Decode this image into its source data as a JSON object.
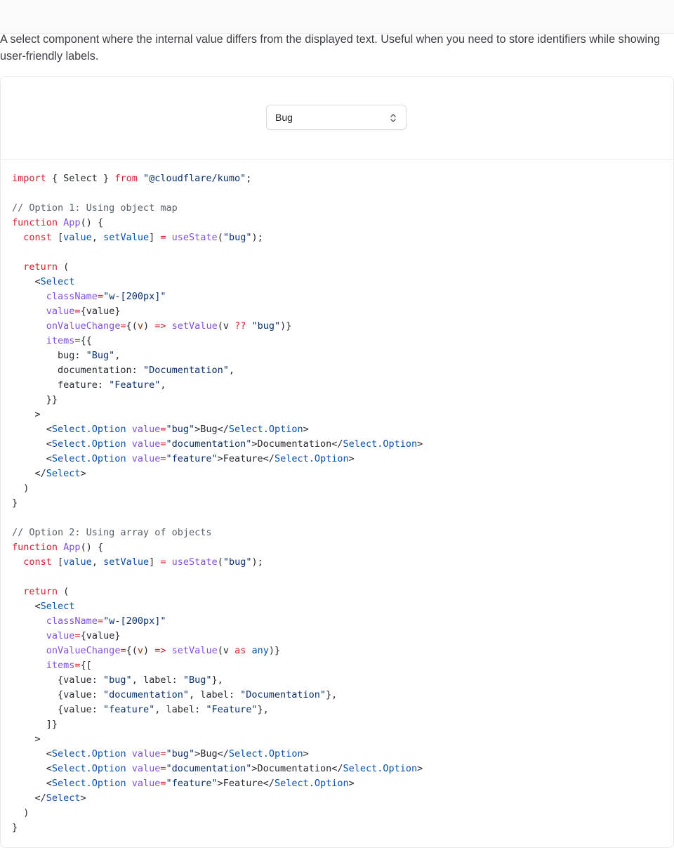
{
  "page": {
    "description": "A select component where the internal value differs from the displayed text. Useful when you need to store identifiers while showing user-friendly labels."
  },
  "preview": {
    "select_value": "Bug",
    "caret_icon": "chevron-up-down-icon"
  },
  "code": {
    "lines": [
      [
        {
          "t": "import",
          "c": "kw"
        },
        {
          "t": " { Select } ",
          "c": ""
        },
        {
          "t": "from",
          "c": "kw"
        },
        {
          "t": " ",
          "c": ""
        },
        {
          "t": "\"@cloudflare/kumo\"",
          "c": "str"
        },
        {
          "t": ";",
          "c": ""
        }
      ],
      [],
      [
        {
          "t": "// Option 1: Using object map",
          "c": "cm"
        }
      ],
      [
        {
          "t": "function",
          "c": "kw"
        },
        {
          "t": " ",
          "c": ""
        },
        {
          "t": "App",
          "c": "fn"
        },
        {
          "t": "() {",
          "c": ""
        }
      ],
      [
        {
          "t": "  ",
          "c": ""
        },
        {
          "t": "const",
          "c": "kw"
        },
        {
          "t": " [",
          "c": ""
        },
        {
          "t": "value",
          "c": "var"
        },
        {
          "t": ", ",
          "c": ""
        },
        {
          "t": "setValue",
          "c": "var"
        },
        {
          "t": "] ",
          "c": ""
        },
        {
          "t": "=",
          "c": "op"
        },
        {
          "t": " ",
          "c": ""
        },
        {
          "t": "useState",
          "c": "fn"
        },
        {
          "t": "(",
          "c": ""
        },
        {
          "t": "\"bug\"",
          "c": "str"
        },
        {
          "t": ");",
          "c": ""
        }
      ],
      [],
      [
        {
          "t": "  ",
          "c": ""
        },
        {
          "t": "return",
          "c": "kw"
        },
        {
          "t": " (",
          "c": ""
        }
      ],
      [
        {
          "t": "    <",
          "c": ""
        },
        {
          "t": "Select",
          "c": "tag"
        }
      ],
      [
        {
          "t": "      ",
          "c": ""
        },
        {
          "t": "className",
          "c": "attr"
        },
        {
          "t": "=",
          "c": "op"
        },
        {
          "t": "\"w-[200px]\"",
          "c": "str"
        }
      ],
      [
        {
          "t": "      ",
          "c": ""
        },
        {
          "t": "value",
          "c": "attr"
        },
        {
          "t": "=",
          "c": "op"
        },
        {
          "t": "{value}",
          "c": ""
        }
      ],
      [
        {
          "t": "      ",
          "c": ""
        },
        {
          "t": "onValueChange",
          "c": "attr"
        },
        {
          "t": "=",
          "c": "op"
        },
        {
          "t": "{(",
          "c": ""
        },
        {
          "t": "v",
          "c": "prm"
        },
        {
          "t": ") ",
          "c": ""
        },
        {
          "t": "=>",
          "c": "op"
        },
        {
          "t": " ",
          "c": ""
        },
        {
          "t": "setValue",
          "c": "fn"
        },
        {
          "t": "(v ",
          "c": ""
        },
        {
          "t": "??",
          "c": "op"
        },
        {
          "t": " ",
          "c": ""
        },
        {
          "t": "\"bug\"",
          "c": "str"
        },
        {
          "t": ")}",
          "c": ""
        }
      ],
      [
        {
          "t": "      ",
          "c": ""
        },
        {
          "t": "items",
          "c": "attr"
        },
        {
          "t": "=",
          "c": "op"
        },
        {
          "t": "{{",
          "c": ""
        }
      ],
      [
        {
          "t": "        bug: ",
          "c": ""
        },
        {
          "t": "\"Bug\"",
          "c": "str"
        },
        {
          "t": ",",
          "c": ""
        }
      ],
      [
        {
          "t": "        documentation: ",
          "c": ""
        },
        {
          "t": "\"Documentation\"",
          "c": "str"
        },
        {
          "t": ",",
          "c": ""
        }
      ],
      [
        {
          "t": "        feature: ",
          "c": ""
        },
        {
          "t": "\"Feature\"",
          "c": "str"
        },
        {
          "t": ",",
          "c": ""
        }
      ],
      [
        {
          "t": "      }}",
          "c": ""
        }
      ],
      [
        {
          "t": "    >",
          "c": ""
        }
      ],
      [
        {
          "t": "      <",
          "c": ""
        },
        {
          "t": "Select.Option",
          "c": "tag"
        },
        {
          "t": " ",
          "c": ""
        },
        {
          "t": "value",
          "c": "attr"
        },
        {
          "t": "=",
          "c": "op"
        },
        {
          "t": "\"bug\"",
          "c": "str"
        },
        {
          "t": ">Bug</",
          "c": ""
        },
        {
          "t": "Select.Option",
          "c": "tag"
        },
        {
          "t": ">",
          "c": ""
        }
      ],
      [
        {
          "t": "      <",
          "c": ""
        },
        {
          "t": "Select.Option",
          "c": "tag"
        },
        {
          "t": " ",
          "c": ""
        },
        {
          "t": "value",
          "c": "attr"
        },
        {
          "t": "=",
          "c": "op"
        },
        {
          "t": "\"documentation\"",
          "c": "str"
        },
        {
          "t": ">Documentation</",
          "c": ""
        },
        {
          "t": "Select.Option",
          "c": "tag"
        },
        {
          "t": ">",
          "c": ""
        }
      ],
      [
        {
          "t": "      <",
          "c": ""
        },
        {
          "t": "Select.Option",
          "c": "tag"
        },
        {
          "t": " ",
          "c": ""
        },
        {
          "t": "value",
          "c": "attr"
        },
        {
          "t": "=",
          "c": "op"
        },
        {
          "t": "\"feature\"",
          "c": "str"
        },
        {
          "t": ">Feature</",
          "c": ""
        },
        {
          "t": "Select.Option",
          "c": "tag"
        },
        {
          "t": ">",
          "c": ""
        }
      ],
      [
        {
          "t": "    </",
          "c": ""
        },
        {
          "t": "Select",
          "c": "tag"
        },
        {
          "t": ">",
          "c": ""
        }
      ],
      [
        {
          "t": "  )",
          "c": ""
        }
      ],
      [
        {
          "t": "}",
          "c": ""
        }
      ],
      [],
      [
        {
          "t": "// Option 2: Using array of objects",
          "c": "cm"
        }
      ],
      [
        {
          "t": "function",
          "c": "kw"
        },
        {
          "t": " ",
          "c": ""
        },
        {
          "t": "App",
          "c": "fn"
        },
        {
          "t": "() {",
          "c": ""
        }
      ],
      [
        {
          "t": "  ",
          "c": ""
        },
        {
          "t": "const",
          "c": "kw"
        },
        {
          "t": " [",
          "c": ""
        },
        {
          "t": "value",
          "c": "var"
        },
        {
          "t": ", ",
          "c": ""
        },
        {
          "t": "setValue",
          "c": "var"
        },
        {
          "t": "] ",
          "c": ""
        },
        {
          "t": "=",
          "c": "op"
        },
        {
          "t": " ",
          "c": ""
        },
        {
          "t": "useState",
          "c": "fn"
        },
        {
          "t": "(",
          "c": ""
        },
        {
          "t": "\"bug\"",
          "c": "str"
        },
        {
          "t": ");",
          "c": ""
        }
      ],
      [],
      [
        {
          "t": "  ",
          "c": ""
        },
        {
          "t": "return",
          "c": "kw"
        },
        {
          "t": " (",
          "c": ""
        }
      ],
      [
        {
          "t": "    <",
          "c": ""
        },
        {
          "t": "Select",
          "c": "tag"
        }
      ],
      [
        {
          "t": "      ",
          "c": ""
        },
        {
          "t": "className",
          "c": "attr"
        },
        {
          "t": "=",
          "c": "op"
        },
        {
          "t": "\"w-[200px]\"",
          "c": "str"
        }
      ],
      [
        {
          "t": "      ",
          "c": ""
        },
        {
          "t": "value",
          "c": "attr"
        },
        {
          "t": "=",
          "c": "op"
        },
        {
          "t": "{value}",
          "c": ""
        }
      ],
      [
        {
          "t": "      ",
          "c": ""
        },
        {
          "t": "onValueChange",
          "c": "attr"
        },
        {
          "t": "=",
          "c": "op"
        },
        {
          "t": "{(",
          "c": ""
        },
        {
          "t": "v",
          "c": "prm"
        },
        {
          "t": ") ",
          "c": ""
        },
        {
          "t": "=>",
          "c": "op"
        },
        {
          "t": " ",
          "c": ""
        },
        {
          "t": "setValue",
          "c": "fn"
        },
        {
          "t": "(v ",
          "c": ""
        },
        {
          "t": "as",
          "c": "kw"
        },
        {
          "t": " ",
          "c": ""
        },
        {
          "t": "any",
          "c": "var"
        },
        {
          "t": ")}",
          "c": ""
        }
      ],
      [
        {
          "t": "      ",
          "c": ""
        },
        {
          "t": "items",
          "c": "attr"
        },
        {
          "t": "=",
          "c": "op"
        },
        {
          "t": "{[",
          "c": ""
        }
      ],
      [
        {
          "t": "        {value: ",
          "c": ""
        },
        {
          "t": "\"bug\"",
          "c": "str"
        },
        {
          "t": ", label: ",
          "c": ""
        },
        {
          "t": "\"Bug\"",
          "c": "str"
        },
        {
          "t": "},",
          "c": ""
        }
      ],
      [
        {
          "t": "        {value: ",
          "c": ""
        },
        {
          "t": "\"documentation\"",
          "c": "str"
        },
        {
          "t": ", label: ",
          "c": ""
        },
        {
          "t": "\"Documentation\"",
          "c": "str"
        },
        {
          "t": "},",
          "c": ""
        }
      ],
      [
        {
          "t": "        {value: ",
          "c": ""
        },
        {
          "t": "\"feature\"",
          "c": "str"
        },
        {
          "t": ", label: ",
          "c": ""
        },
        {
          "t": "\"Feature\"",
          "c": "str"
        },
        {
          "t": "},",
          "c": ""
        }
      ],
      [
        {
          "t": "      ]}",
          "c": ""
        }
      ],
      [
        {
          "t": "    >",
          "c": ""
        }
      ],
      [
        {
          "t": "      <",
          "c": ""
        },
        {
          "t": "Select.Option",
          "c": "tag"
        },
        {
          "t": " ",
          "c": ""
        },
        {
          "t": "value",
          "c": "attr"
        },
        {
          "t": "=",
          "c": "op"
        },
        {
          "t": "\"bug\"",
          "c": "str"
        },
        {
          "t": ">Bug</",
          "c": ""
        },
        {
          "t": "Select.Option",
          "c": "tag"
        },
        {
          "t": ">",
          "c": ""
        }
      ],
      [
        {
          "t": "      <",
          "c": ""
        },
        {
          "t": "Select.Option",
          "c": "tag"
        },
        {
          "t": " ",
          "c": ""
        },
        {
          "t": "value",
          "c": "attr"
        },
        {
          "t": "=",
          "c": "op"
        },
        {
          "t": "\"documentation\"",
          "c": "str"
        },
        {
          "t": ">Documentation</",
          "c": ""
        },
        {
          "t": "Select.Option",
          "c": "tag"
        },
        {
          "t": ">",
          "c": ""
        }
      ],
      [
        {
          "t": "      <",
          "c": ""
        },
        {
          "t": "Select.Option",
          "c": "tag"
        },
        {
          "t": " ",
          "c": ""
        },
        {
          "t": "value",
          "c": "attr"
        },
        {
          "t": "=",
          "c": "op"
        },
        {
          "t": "\"feature\"",
          "c": "str"
        },
        {
          "t": ">Feature</",
          "c": ""
        },
        {
          "t": "Select.Option",
          "c": "tag"
        },
        {
          "t": ">",
          "c": ""
        }
      ],
      [
        {
          "t": "    </",
          "c": ""
        },
        {
          "t": "Select",
          "c": "tag"
        },
        {
          "t": ">",
          "c": ""
        }
      ],
      [
        {
          "t": "  )",
          "c": ""
        }
      ],
      [
        {
          "t": "}",
          "c": ""
        }
      ]
    ]
  }
}
